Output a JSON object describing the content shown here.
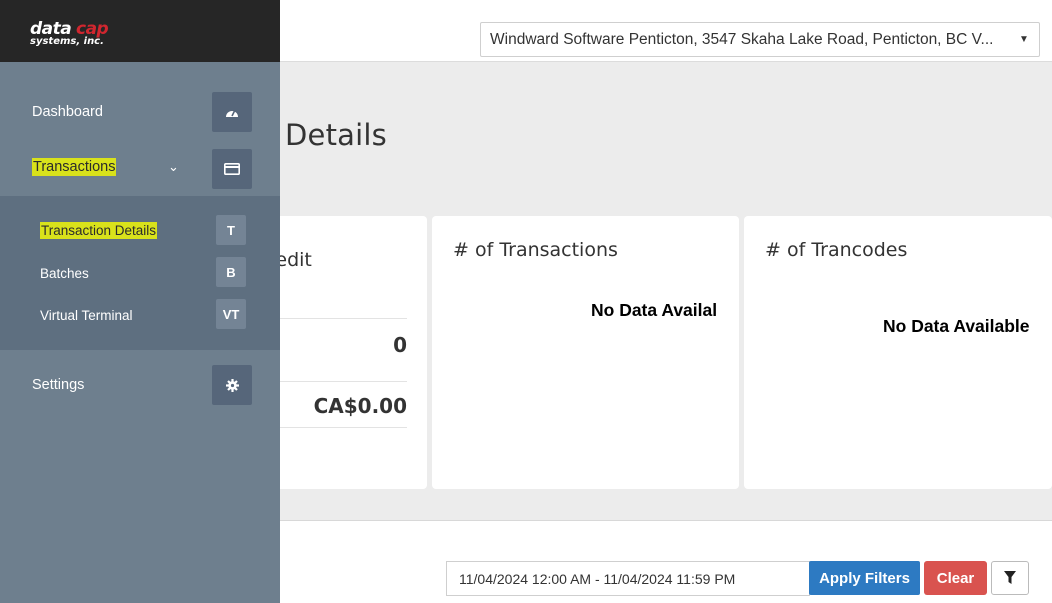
{
  "brand": {
    "logo_text_top": "datacap",
    "logo_text_bottom": "systems, inc."
  },
  "header": {
    "location_selected": "Windward Software Penticton, 3547 Skaha Lake Road, Penticton, BC V..."
  },
  "page": {
    "title": "Details"
  },
  "sidebar": {
    "dashboard": "Dashboard",
    "transactions": "Transactions",
    "settings": "Settings",
    "sub_items": [
      {
        "label": "Transaction Details",
        "key": "T"
      },
      {
        "label": "Batches",
        "key": "B"
      },
      {
        "label": "Virtual Terminal",
        "key": "VT"
      }
    ]
  },
  "cards": {
    "credit": {
      "title": "redit",
      "count": "0",
      "amount": "CA$0.00"
    },
    "transactions": {
      "title": "# of Transactions",
      "empty": "No Data Availal"
    },
    "trancodes": {
      "title": "# of Trancodes",
      "empty": "No Data Available"
    }
  },
  "filters": {
    "date_range": "11/04/2024 12:00 AM - 11/04/2024 11:59 PM",
    "apply": "Apply Filters",
    "clear": "Clear"
  },
  "colors": {
    "sidebar": "#6e7f8e",
    "highlight": "#d9e21b",
    "apply": "#2d7ac2",
    "clear": "#d9534f"
  }
}
